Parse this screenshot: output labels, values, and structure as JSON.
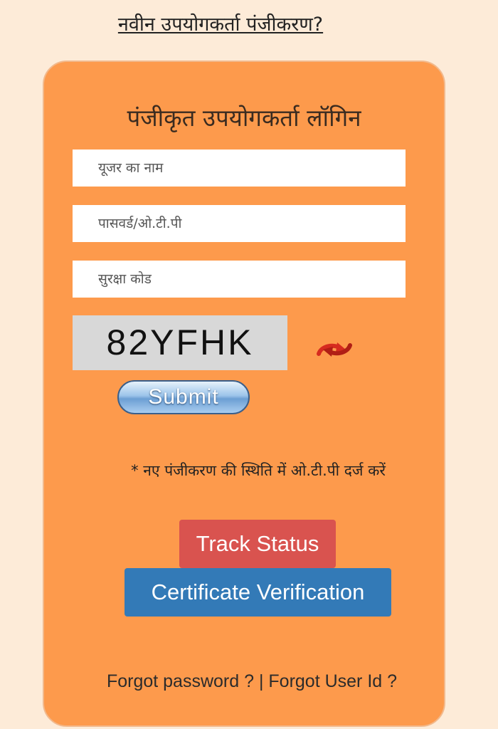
{
  "header": {
    "new_registration_link": "नवीन उपयोगकर्ता पंजीकरण?"
  },
  "login": {
    "title": "पंजीकृत उपयोगकर्ता लॉगिन",
    "username_placeholder": "यूजर का नाम",
    "password_placeholder": "पासवर्ड/ओ.टी.पी",
    "security_code_placeholder": "सुरक्षा कोड",
    "captcha_text": "82YFHK",
    "refresh_icon": "refresh-arrows-icon",
    "submit_label": "Submit",
    "otp_note": "* नए पंजीकरण की स्थिति में ओ.टी.पी दर्ज करें"
  },
  "actions": {
    "track_status_label": "Track Status",
    "certificate_verification_label": "Certificate Verification"
  },
  "footer": {
    "forgot_password": "Forgot password ?",
    "separator": " | ",
    "forgot_user_id": "Forgot User Id ?"
  },
  "colors": {
    "page_bg": "#fdebd8",
    "panel_bg": "#fd9a4c",
    "track_status_bg": "#d9534f",
    "certificate_bg": "#337ab7",
    "refresh_icon": "#d62b1f"
  }
}
